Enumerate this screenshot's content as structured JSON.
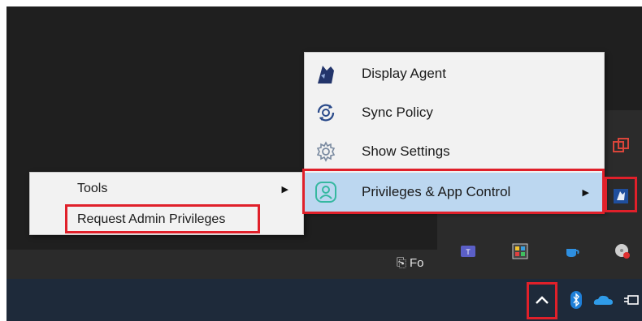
{
  "context_menu": {
    "items": [
      {
        "label": "Display Agent",
        "icon": "agent-icon"
      },
      {
        "label": "Sync Policy",
        "icon": "sync-icon"
      },
      {
        "label": "Show Settings",
        "icon": "gear-icon"
      },
      {
        "label": "Privileges & App Control",
        "icon": "shield-user-icon",
        "has_submenu": true,
        "active": true
      }
    ]
  },
  "submenu": {
    "items": [
      {
        "label": "Tools",
        "has_submenu": true
      },
      {
        "label": "Request Admin Privileges"
      }
    ]
  },
  "taskbar": {
    "file_label": "Fo"
  },
  "colors": {
    "highlight": "#e0202a",
    "menu_bg": "#f2f2f2",
    "active_item": "#bcd7f0",
    "taskbar": "#1e2a3a"
  }
}
